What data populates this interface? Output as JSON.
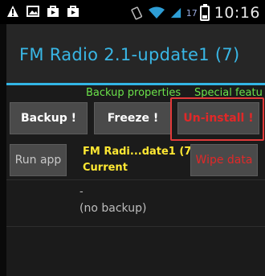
{
  "status_bar": {
    "time": "10:16",
    "battery_percent": "17",
    "icons": [
      "warning-icon",
      "image-icon",
      "shopping-bag-icon",
      "play-store-icon",
      "vibrate-icon",
      "wifi-icon",
      "signal-icon",
      "battery-icon"
    ]
  },
  "dialog": {
    "title": "FM Radio 2.1-update1 (7)",
    "tabs": [
      "Backup properties",
      "Special featu"
    ],
    "buttons": {
      "backup": "Backup !",
      "freeze": "Freeze !",
      "uninstall": "Un-install !",
      "run_app": "Run app",
      "wipe_data": "Wipe data"
    },
    "app_info": {
      "name": "FM Radi...date1 (7)",
      "status": "Current"
    },
    "backup_info": {
      "dash": "-",
      "none": "(no backup)"
    }
  },
  "colors": {
    "title": "#39b7e6",
    "accent_rule": "#33b5e5",
    "tab_text": "#6be24a",
    "highlight": "#e23a3a",
    "info_text": "#ffe833",
    "danger_text": "#e12828"
  }
}
